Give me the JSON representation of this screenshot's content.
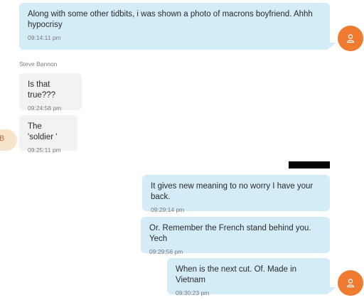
{
  "messages": [
    {
      "text": "Along with some other tidbits, i was shown a photo of macrons boyfriend.  Ahhh hypocrisy",
      "time": "09:14:11 pm"
    },
    {
      "text": "Is that true???",
      "time": "09:24:58 pm"
    },
    {
      "text": "The 'soldier '",
      "time": "09:25:11 pm"
    },
    {
      "text": "It gives new meaning to no worry I have your back.",
      "time": "09:29:14 pm"
    },
    {
      "text": "Or.  Remember the French stand behind you.  Yech",
      "time": "09:29:56 pm"
    },
    {
      "text": "When is the next cut. Of.   Made in Vietnam",
      "time": "09:30:23 pm"
    }
  ],
  "sender_name": "Steve Bannon",
  "partial_avatar_letter": "B",
  "colors": {
    "outgoing_bubble": "#d4ecf7",
    "incoming_bubble": "#f2f2f2",
    "avatar": "#f07a2f"
  },
  "icons": {
    "avatar": "user-icon"
  }
}
